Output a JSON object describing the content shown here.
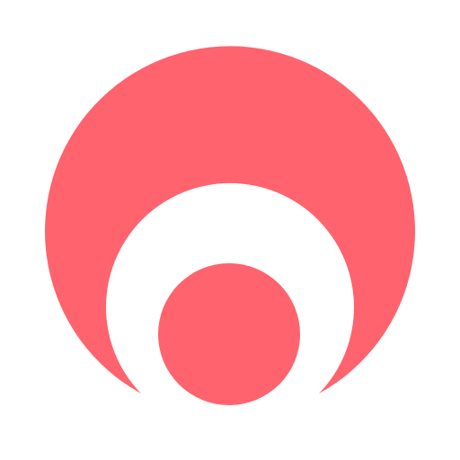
{
  "icon": {
    "name": "concentric-arc-logo-icon",
    "colors": {
      "background": "#ffffff",
      "brand": "#FF636E"
    }
  }
}
